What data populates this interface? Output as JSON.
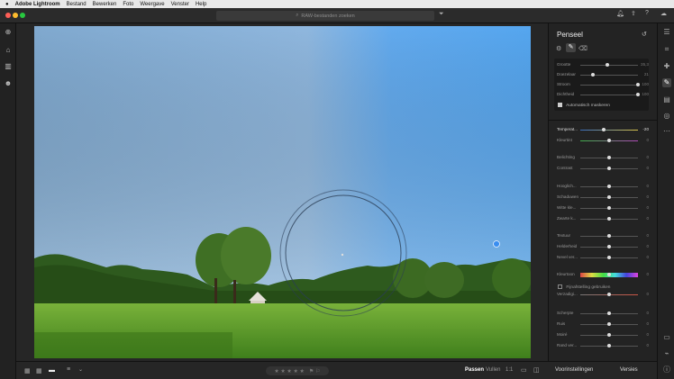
{
  "menubar": {
    "apple": "",
    "items": [
      "Adobe Lightroom",
      "Bestand",
      "Bewerken",
      "Foto",
      "Weergave",
      "Venster",
      "Help"
    ]
  },
  "toolbar": {
    "search_placeholder": "RAW-bestanden zoeken"
  },
  "panel": {
    "title": "Penseel",
    "brush": [
      {
        "label": "Grootte",
        "value": "35,3",
        "pos": 0.45
      },
      {
        "label": "Doezelaar",
        "value": "21",
        "pos": 0.2
      },
      {
        "label": "Stroom",
        "value": "100",
        "pos": 1.0
      },
      {
        "label": "Dichtheid",
        "value": "100",
        "pos": 1.0
      }
    ],
    "auto_mask_label": "Automatisch maskeren",
    "sliders": [
      {
        "label": "Temperat...",
        "value": "-20",
        "pos": 0.4,
        "bright": true
      },
      {
        "label": "Kleurtint",
        "value": "0",
        "pos": 0.5
      },
      {
        "label": "Belichting",
        "value": "0",
        "pos": 0.5
      },
      {
        "label": "Contrast",
        "value": "0",
        "pos": 0.5
      },
      {
        "label": "Hooglich...",
        "value": "0",
        "pos": 0.5
      },
      {
        "label": "Schaduwen",
        "value": "0",
        "pos": 0.5
      },
      {
        "label": "Witte kle...",
        "value": "0",
        "pos": 0.5
      },
      {
        "label": "Zwarte k...",
        "value": "0",
        "pos": 0.5
      },
      {
        "label": "Textuur",
        "value": "0",
        "pos": 0.5
      },
      {
        "label": "Helderheid",
        "value": "0",
        "pos": 0.5
      },
      {
        "label": "Nevel ver...",
        "value": "0",
        "pos": 0.5
      },
      {
        "label": "Kleurtoon",
        "value": "0",
        "pos": 0.5
      },
      {
        "label": "Verzadigi...",
        "value": "0",
        "pos": 0.5
      },
      {
        "label": "Scherpte",
        "value": "0",
        "pos": 0.5
      },
      {
        "label": "Ruis",
        "value": "0",
        "pos": 0.5
      },
      {
        "label": "Moiré",
        "value": "0",
        "pos": 0.5
      },
      {
        "label": "Rand ver...",
        "value": "0",
        "pos": 0.5
      }
    ],
    "fine_adjust_label": "Fijnafstelling gebruiken"
  },
  "bottombar": {
    "fit": "Passen",
    "fill": "Vullen",
    "ratio": "1:1",
    "stars": "★ ★ ★ ★ ★"
  },
  "footer": {
    "presets": "Voorinstellingen",
    "versions": "Versies"
  },
  "colors": {
    "accent": "#4a9ff5",
    "sky_top": "#6aa6d9",
    "grass": "#5a9a2a"
  }
}
